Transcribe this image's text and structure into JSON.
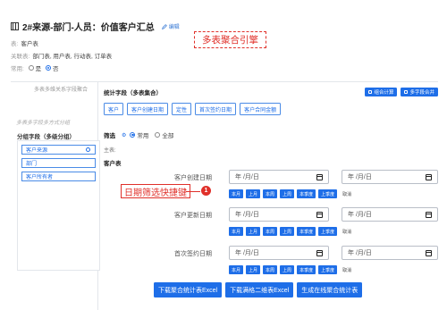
{
  "page": {
    "title": "2#来源-部门-人员：价值客户汇总",
    "edit_label": "编辑",
    "table_label": "表:",
    "table_value": "客户表",
    "related_label": "关联表:",
    "related_value": "部门表, 用户表, 行动表, 订单表",
    "common_label": "常用:",
    "common_options": [
      "是",
      "否"
    ],
    "common_selected": "否"
  },
  "annotations": {
    "engine_label": "多表聚合引擎",
    "date_shortcut_label": "日期筛选快捷键",
    "date_shortcut_number": "1"
  },
  "left": {
    "hint_top": "多表多维关系字段聚合",
    "hint_bottom": "多表多字段多方式分组",
    "group_title": "分组字段（多级分组）",
    "groups": [
      "客户来源",
      "部门",
      "客户所有者"
    ]
  },
  "right": {
    "stats_label": "统计字段（多表集合）",
    "top_buttons": [
      "组合计算",
      "多字段合并"
    ],
    "field_chips": [
      "客户",
      "客户创建日期",
      "定性",
      "首次签约日期",
      "客户合同金额"
    ],
    "filter_label": "筛选",
    "filter_options": [
      "常用",
      "全部"
    ],
    "host_label": "主表:",
    "customer_table_label": "客户表",
    "date_filters": [
      {
        "label": "客户创建日期",
        "placeholder": "年 /月/日"
      },
      {
        "label": "客户更新日期",
        "placeholder": "年 /月/日"
      },
      {
        "label": "首次签约日期",
        "placeholder": "年 /月/日"
      }
    ],
    "quick_buttons": [
      "本月",
      "上月",
      "本周",
      "上周",
      "本季度",
      "上季度",
      "取消"
    ],
    "bottom_buttons": [
      "下载聚合统计表Excel",
      "下载满格二维表Excel",
      "生成在线聚合统计表"
    ]
  }
}
